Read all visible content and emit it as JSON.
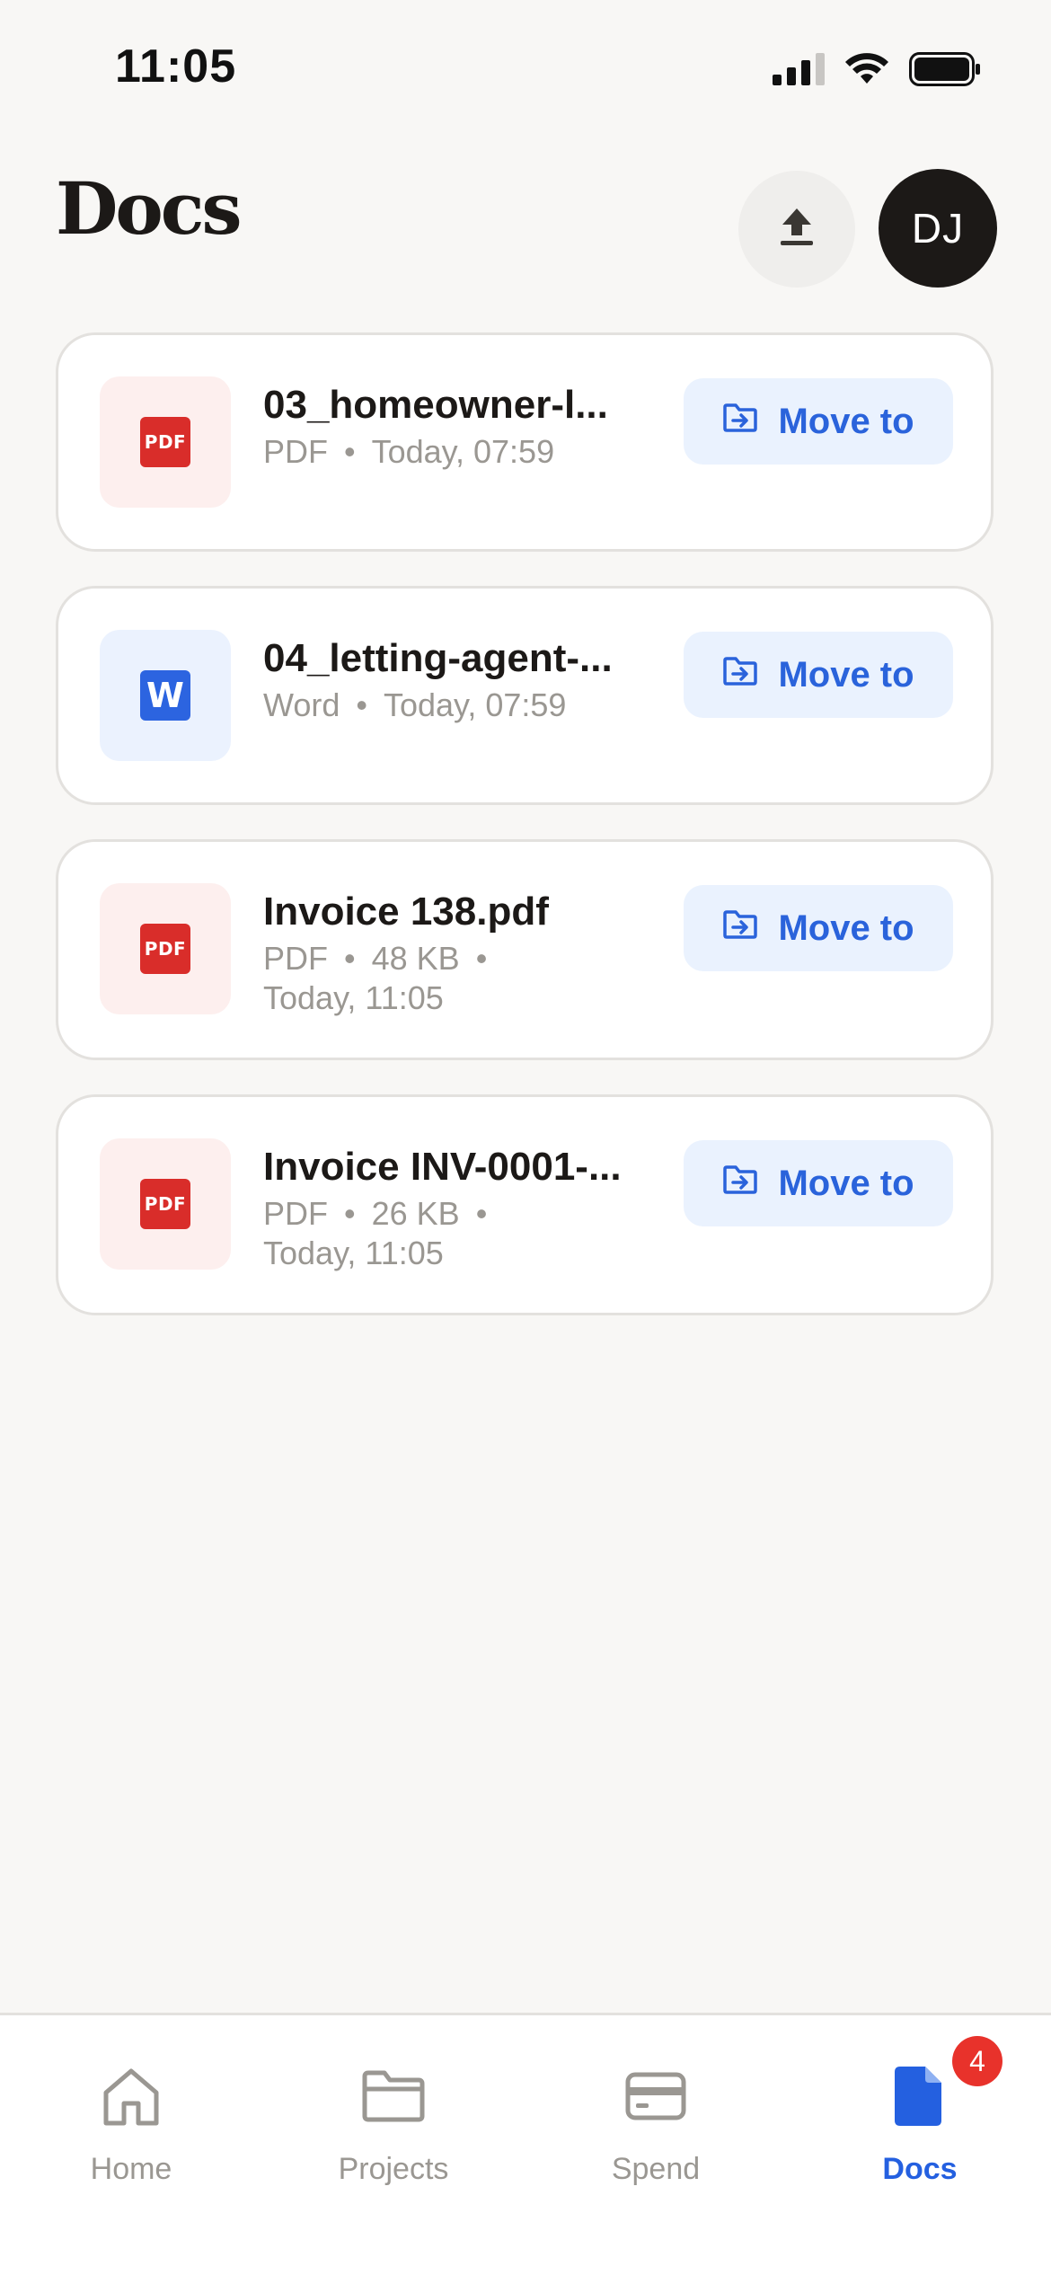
{
  "status_bar": {
    "time": "11:05"
  },
  "header": {
    "title": "Docs",
    "avatar_initials": "DJ",
    "upload_icon": "upload-icon"
  },
  "documents": [
    {
      "name": "03_homeowner-l...",
      "type_icon": "pdf-file-icon",
      "meta": [
        "PDF",
        "Today, 07:59"
      ],
      "action_label": "Move to"
    },
    {
      "name": "04_letting-agent-...",
      "type_icon": "word-file-icon",
      "meta": [
        "Word",
        "Today, 07:59"
      ],
      "action_label": "Move to"
    },
    {
      "name": "Invoice 138.pdf",
      "type_icon": "pdf-file-icon",
      "meta": [
        "PDF",
        "48 KB",
        "Today, 11:05"
      ],
      "action_label": "Move to"
    },
    {
      "name": "Invoice INV-0001-...",
      "type_icon": "pdf-file-icon",
      "meta": [
        "PDF",
        "26 KB",
        "Today, 11:05"
      ],
      "action_label": "Move to"
    }
  ],
  "icons": {
    "pdf_label": "PDF",
    "word_label": "W"
  },
  "tab_bar": {
    "tabs": [
      {
        "label": "Home",
        "icon": "home-icon"
      },
      {
        "label": "Projects",
        "icon": "folder-icon"
      },
      {
        "label": "Spend",
        "icon": "card-icon"
      },
      {
        "label": "Docs",
        "icon": "document-icon"
      }
    ],
    "docs_badge": "4"
  },
  "colors": {
    "accent": "#2A63DB",
    "background": "#F8F7F5",
    "badge": "#E8322B",
    "pdf": "#D92D2A",
    "word": "#2C64E0"
  }
}
